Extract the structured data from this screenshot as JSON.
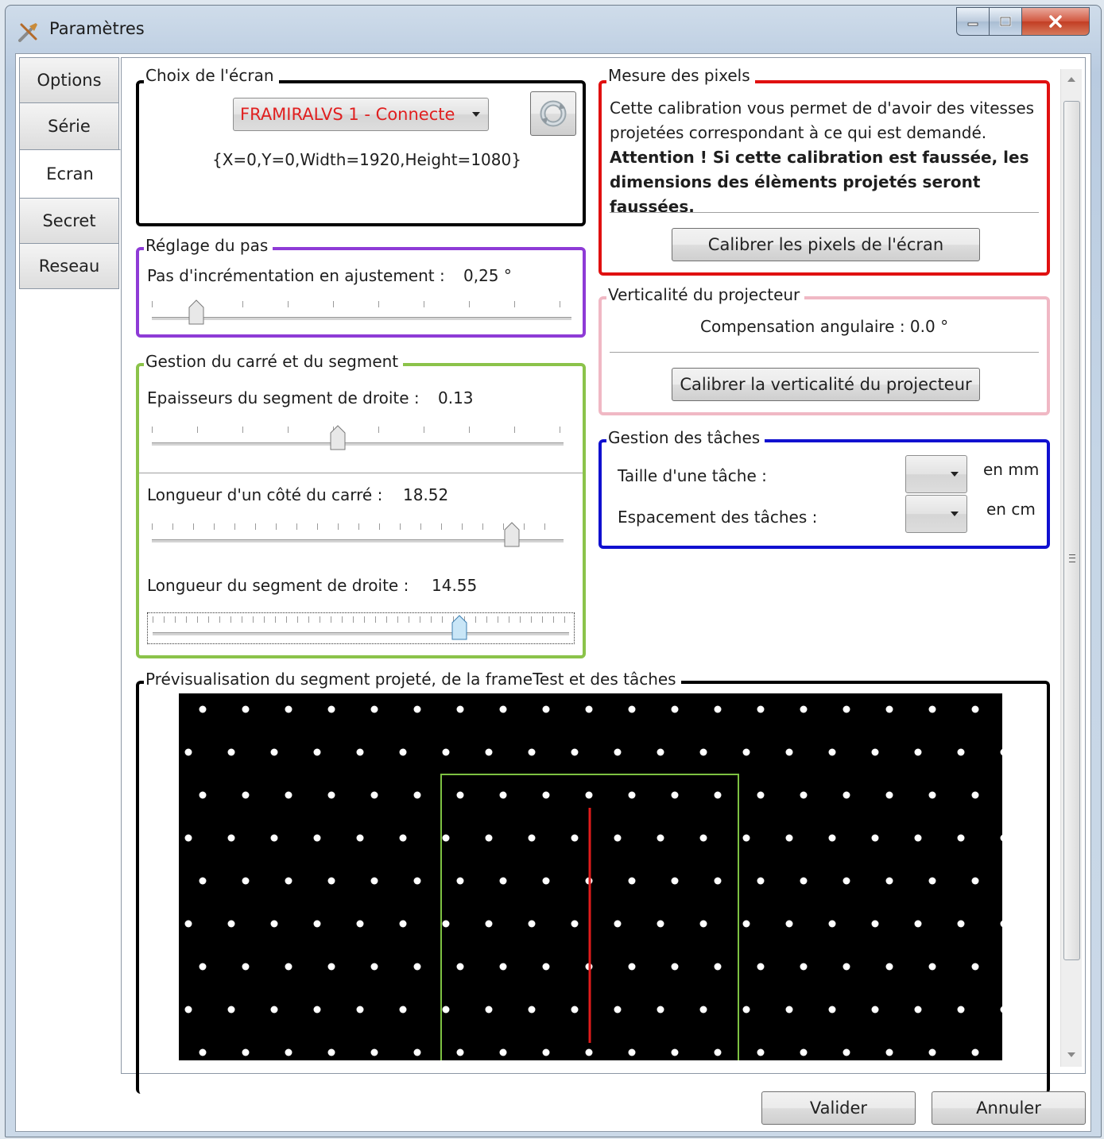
{
  "window": {
    "title": "Paramètres"
  },
  "tabs": [
    {
      "label": "Options",
      "active": false
    },
    {
      "label": "Série",
      "active": false
    },
    {
      "label": "Ecran",
      "active": true
    },
    {
      "label": "Secret",
      "active": false
    },
    {
      "label": "Reseau",
      "active": false
    }
  ],
  "screen_choice": {
    "legend": "Choix de l'écran",
    "selected_screen": "FRAMIRALVS 1 - Connecte",
    "bounds": "{X=0,Y=0,Width=1920,Height=1080}",
    "refresh_icon": "refresh-icon"
  },
  "step": {
    "legend": "Réglage du pas",
    "label": "Pas d'incrémentation en ajustement :",
    "value": "0,25 °",
    "slider_fraction": 0.1
  },
  "square_segment": {
    "legend": "Gestion du carré et du segment",
    "thickness_label": "Epaisseurs du segment de droite :",
    "thickness_value": "0.13",
    "thickness_fraction": 0.45,
    "side_label": "Longueur d'un côté du carré :",
    "side_value": "18.52",
    "side_fraction": 0.88,
    "segment_label": "Longueur du segment de droite :",
    "segment_value": "14.55",
    "segment_fraction": 0.74
  },
  "pixels": {
    "legend": "Mesure des pixels",
    "description": "Cette calibration vous permet de d'avoir des vitesses projetées correspondant à ce qui est demandé.",
    "warning": "Attention ! Si cette calibration est faussée, les dimensions des élèments projetés seront faussées.",
    "button": "Calibrer les pixels de l'écran"
  },
  "verticality": {
    "legend": "Verticalité du projecteur",
    "compensation": "Compensation angulaire : 0.0 °",
    "button": "Calibrer la verticalité du projecteur"
  },
  "tasks": {
    "legend": "Gestion des tâches",
    "size_label": "Taille d'une tâche :",
    "size_unit": "en mm",
    "spacing_label": "Espacement des tâches :",
    "spacing_unit": "en cm"
  },
  "preview": {
    "legend": "Prévisualisation du segment projeté, de la frameTest et des tâches",
    "background": "#000000",
    "dot_color": "#ffffff",
    "square_color": "#7dc142",
    "segment_color": "#e11b1b"
  },
  "footer": {
    "validate": "Valider",
    "cancel": "Annuler"
  },
  "colors": {
    "screen_group": "#000000",
    "step_group": "#8e3bd6",
    "square_group": "#8bc34a",
    "pixels_group": "#e01010",
    "verticality_group": "#f0b8c4",
    "tasks_group": "#1010d0",
    "combo_text": "#e02020"
  }
}
